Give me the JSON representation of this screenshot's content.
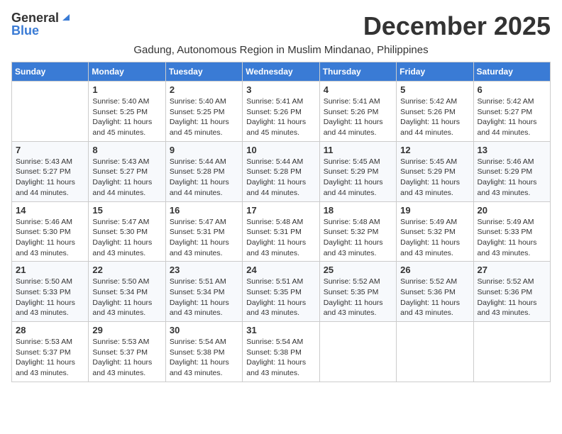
{
  "logo": {
    "general": "General",
    "blue": "Blue"
  },
  "title": "December 2025",
  "subtitle": "Gadung, Autonomous Region in Muslim Mindanao, Philippines",
  "days_of_week": [
    "Sunday",
    "Monday",
    "Tuesday",
    "Wednesday",
    "Thursday",
    "Friday",
    "Saturday"
  ],
  "weeks": [
    [
      {
        "day": "",
        "info": ""
      },
      {
        "day": "1",
        "info": "Sunrise: 5:40 AM\nSunset: 5:25 PM\nDaylight: 11 hours\nand 45 minutes."
      },
      {
        "day": "2",
        "info": "Sunrise: 5:40 AM\nSunset: 5:25 PM\nDaylight: 11 hours\nand 45 minutes."
      },
      {
        "day": "3",
        "info": "Sunrise: 5:41 AM\nSunset: 5:26 PM\nDaylight: 11 hours\nand 45 minutes."
      },
      {
        "day": "4",
        "info": "Sunrise: 5:41 AM\nSunset: 5:26 PM\nDaylight: 11 hours\nand 44 minutes."
      },
      {
        "day": "5",
        "info": "Sunrise: 5:42 AM\nSunset: 5:26 PM\nDaylight: 11 hours\nand 44 minutes."
      },
      {
        "day": "6",
        "info": "Sunrise: 5:42 AM\nSunset: 5:27 PM\nDaylight: 11 hours\nand 44 minutes."
      }
    ],
    [
      {
        "day": "7",
        "info": "Sunrise: 5:43 AM\nSunset: 5:27 PM\nDaylight: 11 hours\nand 44 minutes."
      },
      {
        "day": "8",
        "info": "Sunrise: 5:43 AM\nSunset: 5:27 PM\nDaylight: 11 hours\nand 44 minutes."
      },
      {
        "day": "9",
        "info": "Sunrise: 5:44 AM\nSunset: 5:28 PM\nDaylight: 11 hours\nand 44 minutes."
      },
      {
        "day": "10",
        "info": "Sunrise: 5:44 AM\nSunset: 5:28 PM\nDaylight: 11 hours\nand 44 minutes."
      },
      {
        "day": "11",
        "info": "Sunrise: 5:45 AM\nSunset: 5:29 PM\nDaylight: 11 hours\nand 44 minutes."
      },
      {
        "day": "12",
        "info": "Sunrise: 5:45 AM\nSunset: 5:29 PM\nDaylight: 11 hours\nand 43 minutes."
      },
      {
        "day": "13",
        "info": "Sunrise: 5:46 AM\nSunset: 5:29 PM\nDaylight: 11 hours\nand 43 minutes."
      }
    ],
    [
      {
        "day": "14",
        "info": "Sunrise: 5:46 AM\nSunset: 5:30 PM\nDaylight: 11 hours\nand 43 minutes."
      },
      {
        "day": "15",
        "info": "Sunrise: 5:47 AM\nSunset: 5:30 PM\nDaylight: 11 hours\nand 43 minutes."
      },
      {
        "day": "16",
        "info": "Sunrise: 5:47 AM\nSunset: 5:31 PM\nDaylight: 11 hours\nand 43 minutes."
      },
      {
        "day": "17",
        "info": "Sunrise: 5:48 AM\nSunset: 5:31 PM\nDaylight: 11 hours\nand 43 minutes."
      },
      {
        "day": "18",
        "info": "Sunrise: 5:48 AM\nSunset: 5:32 PM\nDaylight: 11 hours\nand 43 minutes."
      },
      {
        "day": "19",
        "info": "Sunrise: 5:49 AM\nSunset: 5:32 PM\nDaylight: 11 hours\nand 43 minutes."
      },
      {
        "day": "20",
        "info": "Sunrise: 5:49 AM\nSunset: 5:33 PM\nDaylight: 11 hours\nand 43 minutes."
      }
    ],
    [
      {
        "day": "21",
        "info": "Sunrise: 5:50 AM\nSunset: 5:33 PM\nDaylight: 11 hours\nand 43 minutes."
      },
      {
        "day": "22",
        "info": "Sunrise: 5:50 AM\nSunset: 5:34 PM\nDaylight: 11 hours\nand 43 minutes."
      },
      {
        "day": "23",
        "info": "Sunrise: 5:51 AM\nSunset: 5:34 PM\nDaylight: 11 hours\nand 43 minutes."
      },
      {
        "day": "24",
        "info": "Sunrise: 5:51 AM\nSunset: 5:35 PM\nDaylight: 11 hours\nand 43 minutes."
      },
      {
        "day": "25",
        "info": "Sunrise: 5:52 AM\nSunset: 5:35 PM\nDaylight: 11 hours\nand 43 minutes."
      },
      {
        "day": "26",
        "info": "Sunrise: 5:52 AM\nSunset: 5:36 PM\nDaylight: 11 hours\nand 43 minutes."
      },
      {
        "day": "27",
        "info": "Sunrise: 5:52 AM\nSunset: 5:36 PM\nDaylight: 11 hours\nand 43 minutes."
      }
    ],
    [
      {
        "day": "28",
        "info": "Sunrise: 5:53 AM\nSunset: 5:37 PM\nDaylight: 11 hours\nand 43 minutes."
      },
      {
        "day": "29",
        "info": "Sunrise: 5:53 AM\nSunset: 5:37 PM\nDaylight: 11 hours\nand 43 minutes."
      },
      {
        "day": "30",
        "info": "Sunrise: 5:54 AM\nSunset: 5:38 PM\nDaylight: 11 hours\nand 43 minutes."
      },
      {
        "day": "31",
        "info": "Sunrise: 5:54 AM\nSunset: 5:38 PM\nDaylight: 11 hours\nand 43 minutes."
      },
      {
        "day": "",
        "info": ""
      },
      {
        "day": "",
        "info": ""
      },
      {
        "day": "",
        "info": ""
      }
    ]
  ]
}
